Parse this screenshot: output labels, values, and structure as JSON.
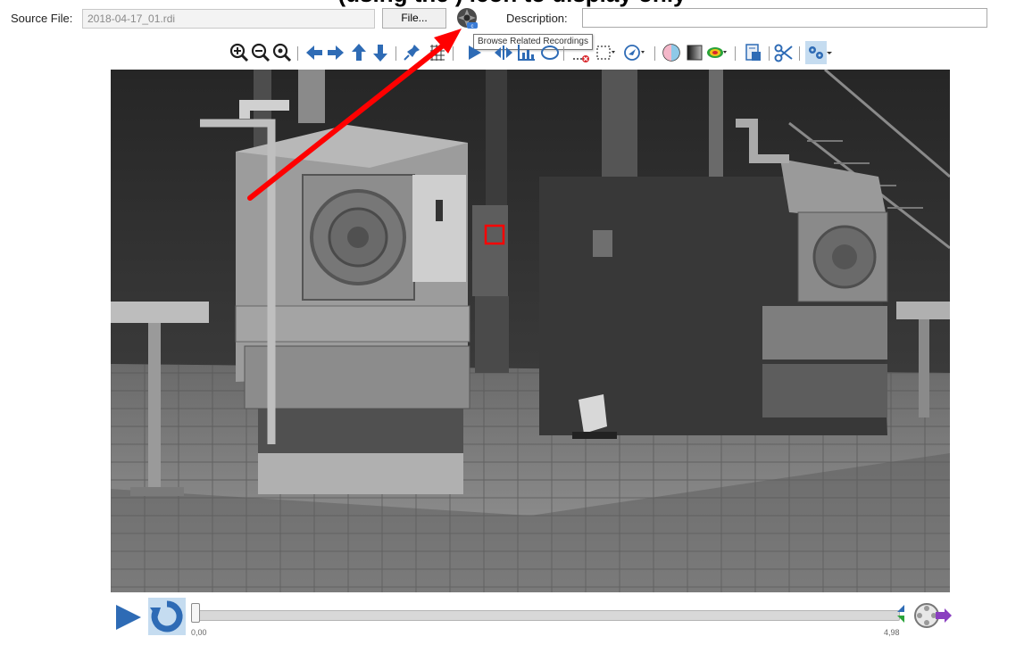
{
  "banner_text": "(using the         ) icon to display only",
  "header": {
    "source_file_label": "Source File:",
    "source_file_value": "2018-04-17_01.rdi",
    "file_button_label": "File...",
    "description_label": "Description:",
    "description_value": ""
  },
  "browse_button": {
    "icon": "aperture-camera-icon",
    "tooltip": "Browse Related Recordings"
  },
  "toolbar": {
    "groups": [
      [
        "zoom-in-icon",
        "zoom-out-icon",
        "zoom-fit-icon"
      ],
      [
        "arrow-left-icon",
        "arrow-right-icon",
        "arrow-up-icon",
        "arrow-down-icon"
      ],
      [
        "pin-icon",
        "grid-icon"
      ],
      [
        "play-marker-icon",
        "split-icon",
        "chart-icon",
        "ellipse-icon",
        "delete-roi-icon",
        "rect-select-icon",
        "navigate-icon"
      ],
      [
        "palette-icon",
        "gradient-icon",
        "heat-blob-icon"
      ],
      [
        "export-icon",
        "scissors-icon",
        "settings-icon"
      ]
    ]
  },
  "image": {
    "description_marker": "roi-red-box",
    "arrow_color": "#ff0000"
  },
  "player": {
    "play_icon": "play-icon",
    "loop_icon": "loop-icon",
    "start_label": "0,00",
    "end_label": "4,98",
    "record_icon": "reel-icon",
    "progress": 0.0
  },
  "colors": {
    "accent": "#2e6bb5",
    "annotation": "#ff0000"
  }
}
